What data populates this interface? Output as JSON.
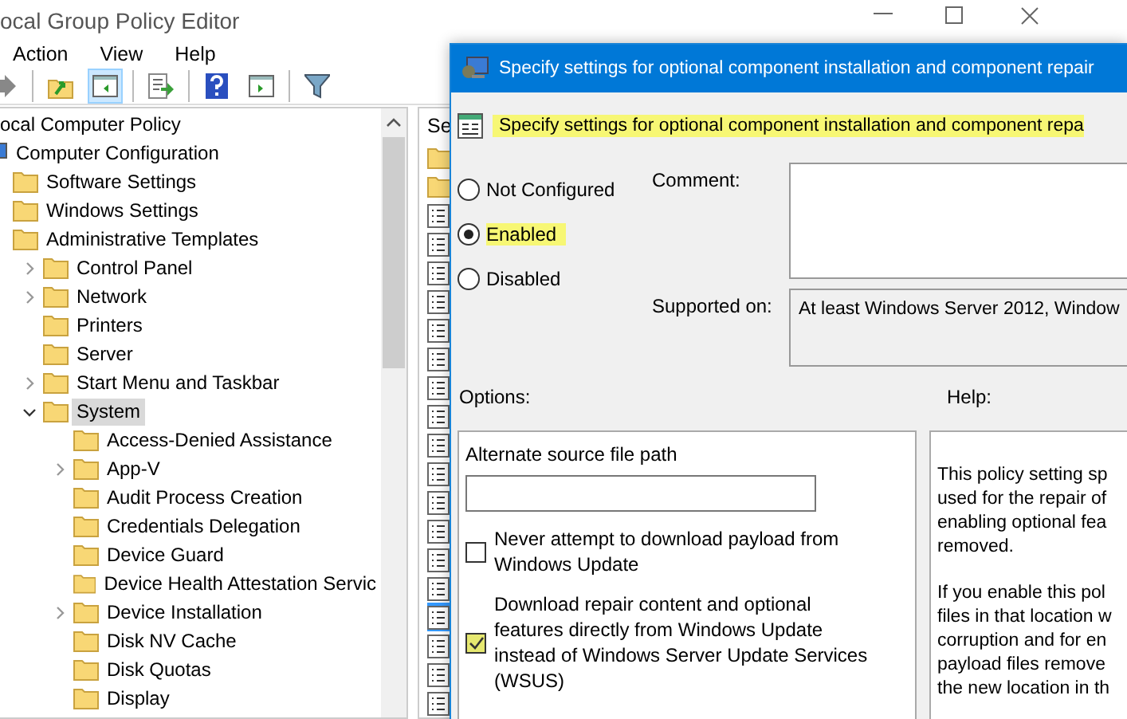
{
  "window": {
    "title": "ocal Group Policy Editor"
  },
  "menu": [
    "Action",
    "View",
    "Help"
  ],
  "toolbar": [
    {
      "kind": "forward",
      "pressed": false
    },
    {
      "kind": "up",
      "pressed": false
    },
    {
      "kind": "pane",
      "pressed": true
    },
    {
      "kind": "export",
      "pressed": false
    },
    {
      "kind": "help",
      "pressed": false
    },
    {
      "kind": "pane2",
      "pressed": false
    },
    {
      "kind": "filter",
      "pressed": false
    }
  ],
  "tree": {
    "label": "ocal Computer Policy",
    "children": [
      {
        "label": "Computer Configuration",
        "kind": "computer",
        "selected": false,
        "children": [
          {
            "label": "Software Settings",
            "kind": "folder",
            "selected": false
          },
          {
            "label": "Windows Settings",
            "kind": "folder",
            "selected": false
          },
          {
            "label": "Administrative Templates",
            "kind": "folder",
            "selected": false,
            "children": [
              {
                "label": "Control Panel",
                "kind": "folder",
                "expanded": false,
                "selected": false
              },
              {
                "label": "Network",
                "kind": "folder",
                "expanded": false,
                "selected": false
              },
              {
                "label": "Printers",
                "kind": "folder",
                "selected": false
              },
              {
                "label": "Server",
                "kind": "folder",
                "selected": false
              },
              {
                "label": "Start Menu and Taskbar",
                "kind": "folder",
                "expanded": false,
                "selected": false
              },
              {
                "label": "System",
                "kind": "folder",
                "expanded": true,
                "selected": true,
                "children": [
                  {
                    "label": "Access-Denied Assistance",
                    "kind": "folder",
                    "selected": false
                  },
                  {
                    "label": "App-V",
                    "kind": "folder",
                    "expanded": false,
                    "selected": false
                  },
                  {
                    "label": "Audit Process Creation",
                    "kind": "folder",
                    "selected": false
                  },
                  {
                    "label": "Credentials Delegation",
                    "kind": "folder",
                    "selected": false
                  },
                  {
                    "label": "Device Guard",
                    "kind": "folder",
                    "selected": false
                  },
                  {
                    "label": "Device Health Attestation Servic",
                    "kind": "folder",
                    "selected": false
                  },
                  {
                    "label": "Device Installation",
                    "kind": "folder",
                    "expanded": false,
                    "selected": false
                  },
                  {
                    "label": "Disk NV Cache",
                    "kind": "folder",
                    "selected": false
                  },
                  {
                    "label": "Disk Quotas",
                    "kind": "folder",
                    "selected": false
                  },
                  {
                    "label": "Display",
                    "kind": "folder",
                    "selected": false
                  }
                ]
              }
            ]
          }
        ]
      }
    ]
  },
  "list_pane": {
    "header": "Se",
    "items": [
      {
        "kind": "folder",
        "selected": false
      },
      {
        "kind": "folder",
        "selected": false
      },
      {
        "kind": "setting",
        "selected": false
      },
      {
        "kind": "setting",
        "selected": false
      },
      {
        "kind": "setting",
        "selected": false
      },
      {
        "kind": "setting",
        "selected": false
      },
      {
        "kind": "setting",
        "selected": false
      },
      {
        "kind": "setting",
        "selected": false
      },
      {
        "kind": "setting",
        "selected": false
      },
      {
        "kind": "setting",
        "selected": false
      },
      {
        "kind": "setting",
        "selected": false
      },
      {
        "kind": "setting",
        "selected": false
      },
      {
        "kind": "setting",
        "selected": false
      },
      {
        "kind": "setting",
        "selected": false
      },
      {
        "kind": "setting",
        "selected": false
      },
      {
        "kind": "setting",
        "selected": false
      },
      {
        "kind": "setting",
        "selected": true
      },
      {
        "kind": "setting",
        "selected": false
      },
      {
        "kind": "setting",
        "selected": false
      },
      {
        "kind": "setting",
        "selected": false
      }
    ]
  },
  "dialog": {
    "title": "Specify settings for optional component installation and component repair",
    "heading": {
      "text": "Specify settings for optional component installation and component repa",
      "highlighted": true
    },
    "states": [
      {
        "label": "Not Configured",
        "selected": false,
        "highlighted": false
      },
      {
        "label": "Enabled",
        "selected": true,
        "highlighted": true
      },
      {
        "label": "Disabled",
        "selected": false,
        "highlighted": false
      }
    ],
    "comment_label": "Comment:",
    "supported_label": "Supported on:",
    "supported_value": "At least Windows Server 2012, Window",
    "options_label": "Options:",
    "help_label": "Help:",
    "options": {
      "path_label": "Alternate source file path",
      "checkboxes": [
        {
          "label": "Never attempt to download payload from Windows Update",
          "checked": false,
          "highlighted": false
        },
        {
          "label": "Download repair content and optional features directly from Windows Update instead of Windows Server Update Services (WSUS)",
          "checked": true,
          "highlighted": true
        }
      ]
    },
    "help": [
      [
        "This policy setting sp",
        "used for the repair of",
        "enabling optional fea",
        "removed."
      ],
      [
        "If you enable this pol",
        "files in that location w",
        "corruption and for en",
        "payload files remove",
        "the new location in th"
      ]
    ]
  }
}
